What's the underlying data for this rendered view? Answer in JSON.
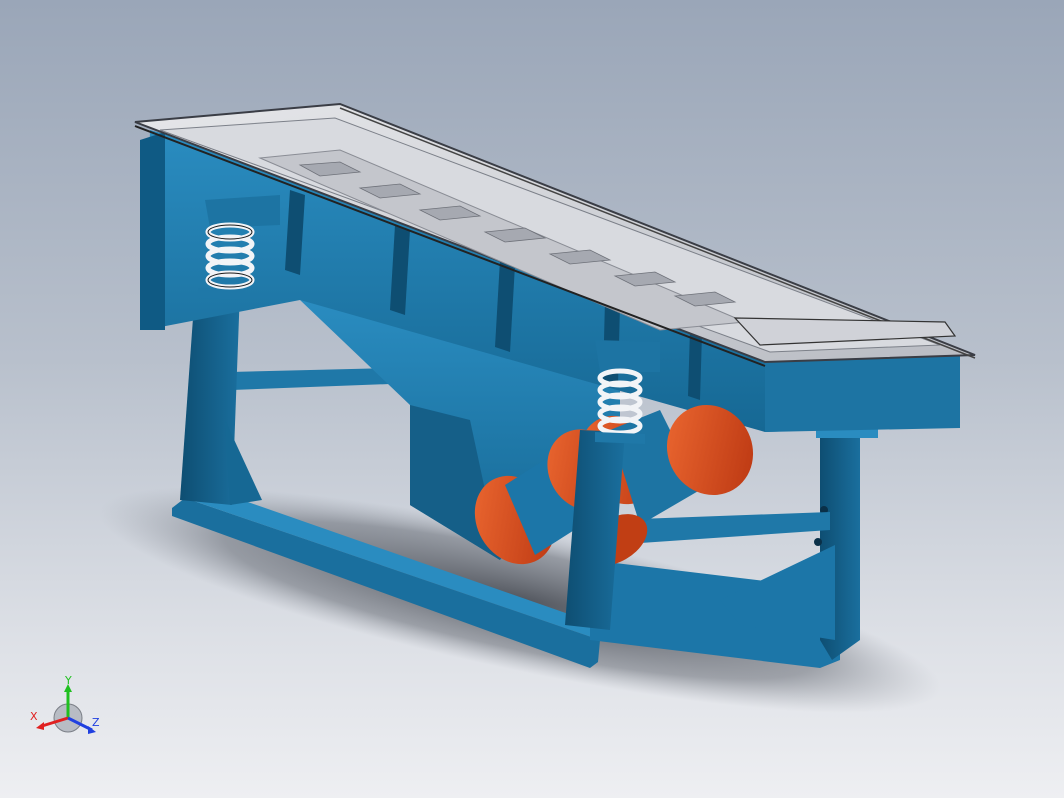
{
  "viewport": {
    "background_top": "#9aa6b8",
    "background_bottom": "#eeeff2",
    "model_colors": {
      "frame_blue": "#1f78a8",
      "frame_blue_dark": "#0f4f74",
      "motor_orange": "#d8441a",
      "spring_white": "#f2f4f7",
      "screen_deck": "#c9ccd3"
    }
  },
  "triad": {
    "x_label": "X",
    "y_label": "Y",
    "z_label": "Z",
    "x_color": "#e02020",
    "y_color": "#20c020",
    "z_color": "#2040e0"
  }
}
